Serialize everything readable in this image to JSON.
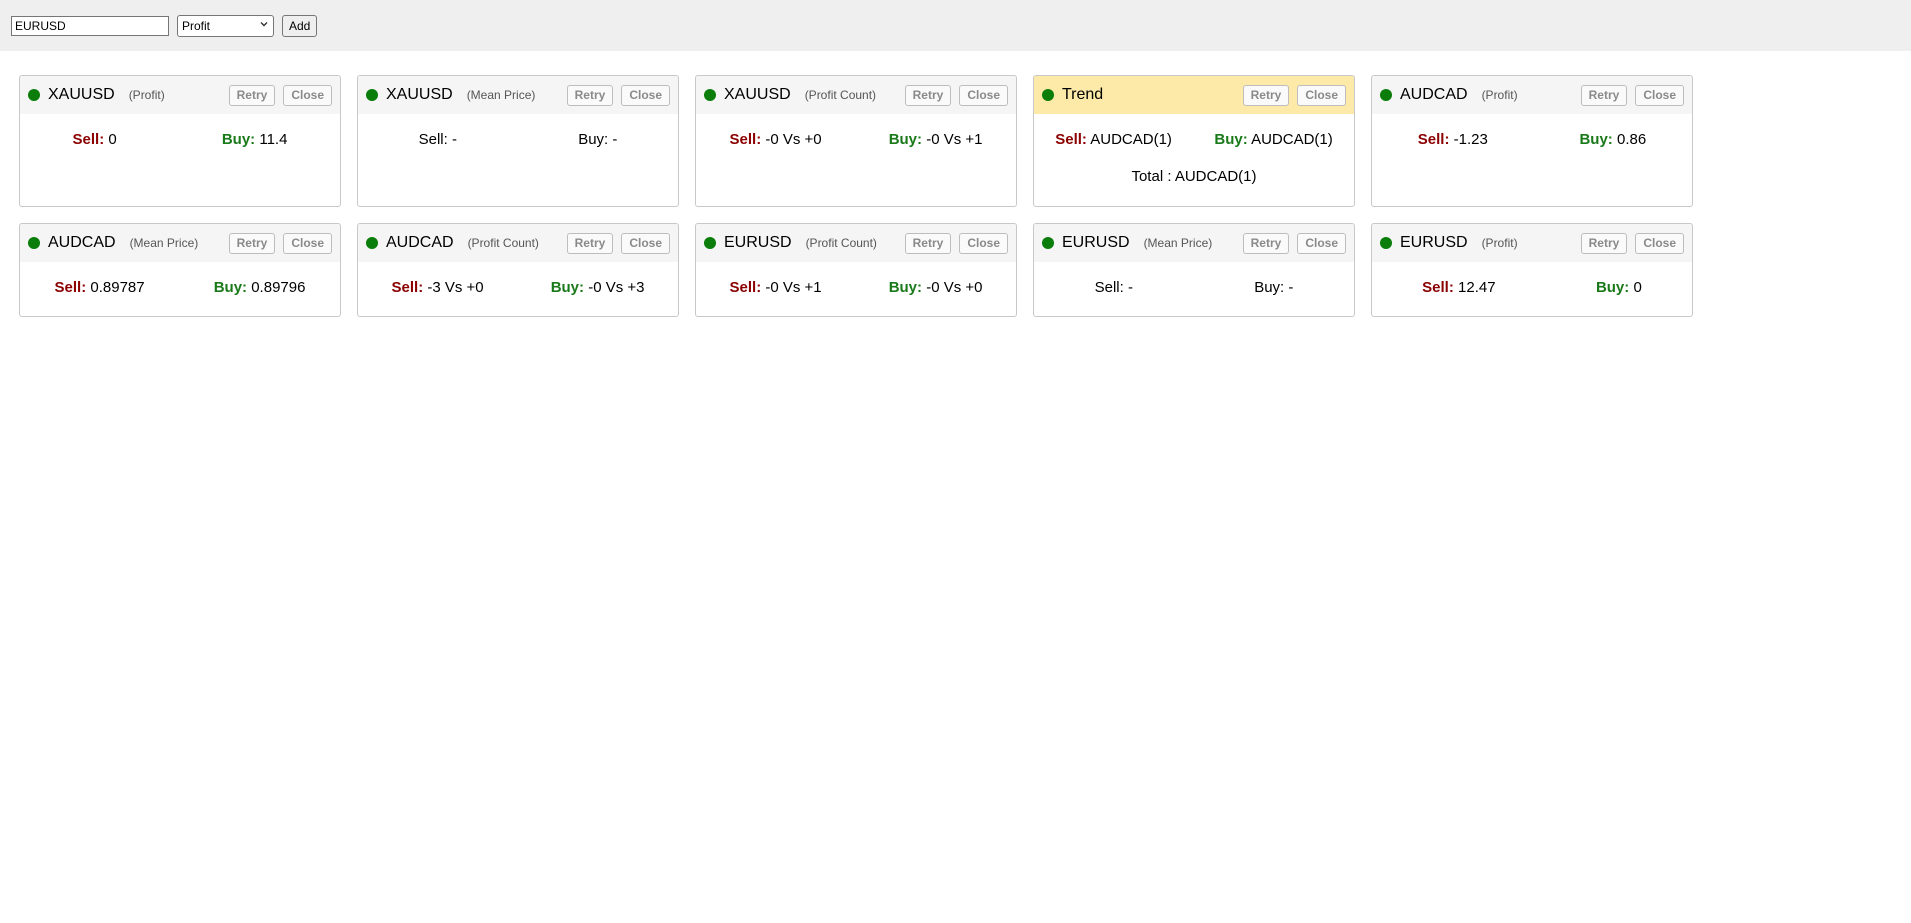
{
  "toolbar": {
    "symbol_value": "EURUSD",
    "mode_selected": "Profit",
    "add_label": "Add"
  },
  "buttons": {
    "retry": "Retry",
    "close": "Close"
  },
  "labels": {
    "sell": "Sell:",
    "buy": "Buy:",
    "total": "Total :"
  },
  "colors": {
    "status_dot": "#0a7d0a",
    "sell": "#8b0000",
    "buy": "#1a7a1a",
    "trend_header": "#fde9a8"
  },
  "cards_row1": [
    {
      "symbol": "XAUUSD",
      "mode": "(Profit)",
      "sell": "0",
      "buy": "11.4",
      "colored": true
    },
    {
      "symbol": "XAUUSD",
      "mode": "(Mean Price)",
      "sell": "-",
      "buy": "-",
      "colored": false
    },
    {
      "symbol": "XAUUSD",
      "mode": "(Profit Count)",
      "sell": "-0 Vs +0",
      "buy": "-0 Vs +1",
      "colored": true
    },
    {
      "symbol": "Trend",
      "mode": "",
      "sell": "AUDCAD(1)",
      "buy": "AUDCAD(1)",
      "total": "AUDCAD(1)",
      "colored": true
    },
    {
      "symbol": "AUDCAD",
      "mode": "(Profit)",
      "sell": "-1.23",
      "buy": "0.86",
      "colored": true
    }
  ],
  "cards_row2": [
    {
      "symbol": "AUDCAD",
      "mode": "(Mean Price)",
      "sell": "0.89787",
      "buy": "0.89796",
      "colored": true
    },
    {
      "symbol": "AUDCAD",
      "mode": "(Profit Count)",
      "sell": "-3 Vs +0",
      "buy": "-0 Vs +3",
      "colored": true
    },
    {
      "symbol": "EURUSD",
      "mode": "(Profit Count)",
      "sell": "-0 Vs +1",
      "buy": "-0 Vs +0",
      "colored": true
    },
    {
      "symbol": "EURUSD",
      "mode": "(Mean Price)",
      "sell": "-",
      "buy": "-",
      "colored": false
    },
    {
      "symbol": "EURUSD",
      "mode": "(Profit)",
      "sell": "12.47",
      "buy": "0",
      "colored": true
    }
  ]
}
